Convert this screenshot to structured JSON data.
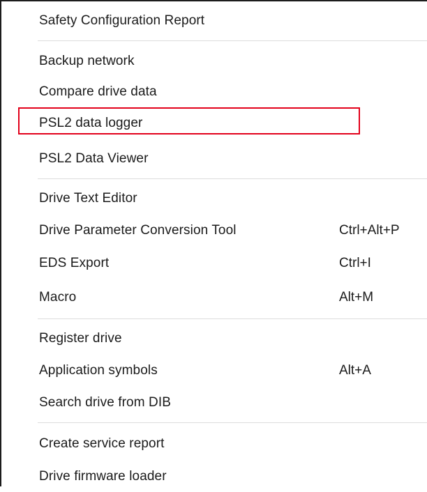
{
  "menu": {
    "items": [
      {
        "label": "Safety Configuration Report",
        "shortcut": ""
      },
      {
        "label": "Backup network",
        "shortcut": ""
      },
      {
        "label": "Compare drive data",
        "shortcut": ""
      },
      {
        "label": "PSL2 data logger",
        "shortcut": ""
      },
      {
        "label": "PSL2 Data Viewer",
        "shortcut": ""
      },
      {
        "label": "Drive Text Editor",
        "shortcut": ""
      },
      {
        "label": "Drive Parameter Conversion Tool",
        "shortcut": "Ctrl+Alt+P"
      },
      {
        "label": "EDS Export",
        "shortcut": "Ctrl+I"
      },
      {
        "label": "Macro",
        "shortcut": "Alt+M"
      },
      {
        "label": "Register drive",
        "shortcut": ""
      },
      {
        "label": "Application symbols",
        "shortcut": "Alt+A"
      },
      {
        "label": "Search drive from DIB",
        "shortcut": ""
      },
      {
        "label": "Create service report",
        "shortcut": ""
      },
      {
        "label": "Drive firmware loader",
        "shortcut": ""
      }
    ]
  },
  "colors": {
    "highlight_border": "#e2001a",
    "separator": "#dcdcdc",
    "text": "#1a1a1a"
  }
}
